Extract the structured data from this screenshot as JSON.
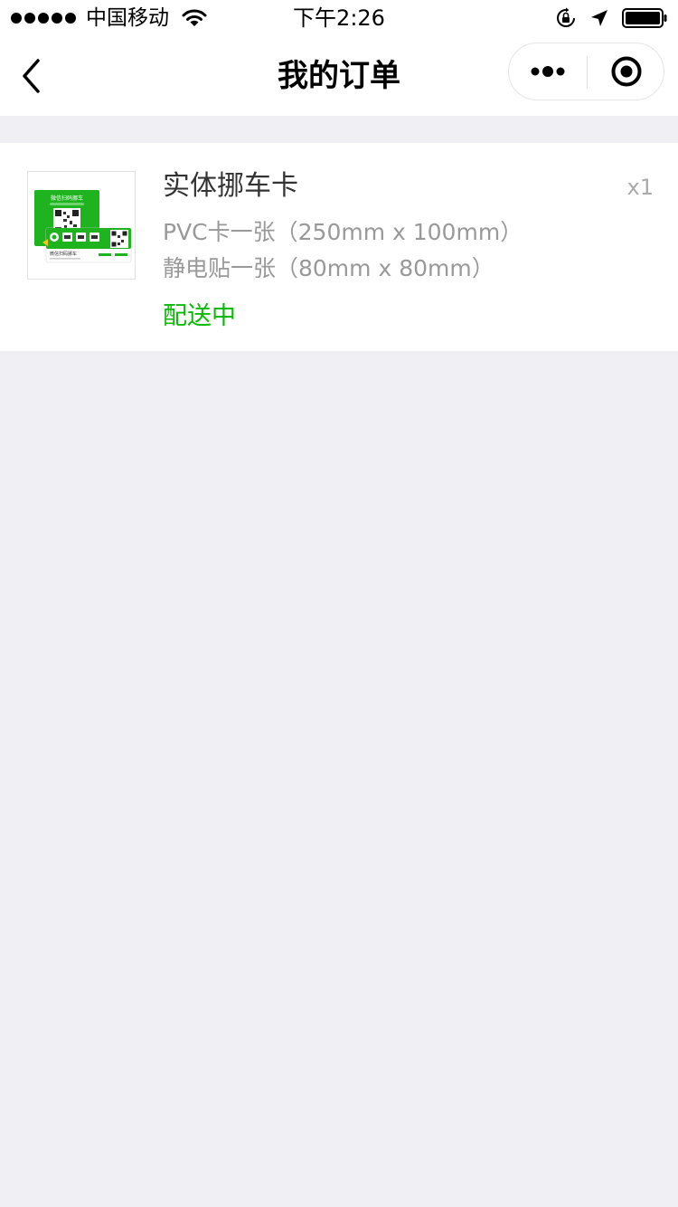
{
  "status_bar": {
    "carrier": "中国移动",
    "time": "下午2:26",
    "signal_icon": "signal-dots-icon",
    "wifi_icon": "wifi-icon",
    "lock_icon": "orientation-lock-icon",
    "location_icon": "location-arrow-icon",
    "battery_icon": "battery-icon"
  },
  "nav": {
    "title": "我的订单",
    "back_icon": "chevron-left-icon",
    "more_icon": "more-dots-icon",
    "close_icon": "record-circle-icon"
  },
  "orders": [
    {
      "name": "实体挪车卡",
      "quantity": "x1",
      "specs": [
        "PVC卡一张（250mm x 100mm）",
        "静电贴一张（80mm x 80mm）"
      ],
      "status": "配送中",
      "thumbnail": {
        "card_title": "微信扫码挪车",
        "sticker_title": "微信扫码挪车"
      }
    }
  ],
  "colors": {
    "page_background": "#efeff4",
    "accent_green": "#09bb07",
    "card_background": "#ffffff",
    "text_primary": "#333333",
    "text_secondary": "#999999"
  }
}
